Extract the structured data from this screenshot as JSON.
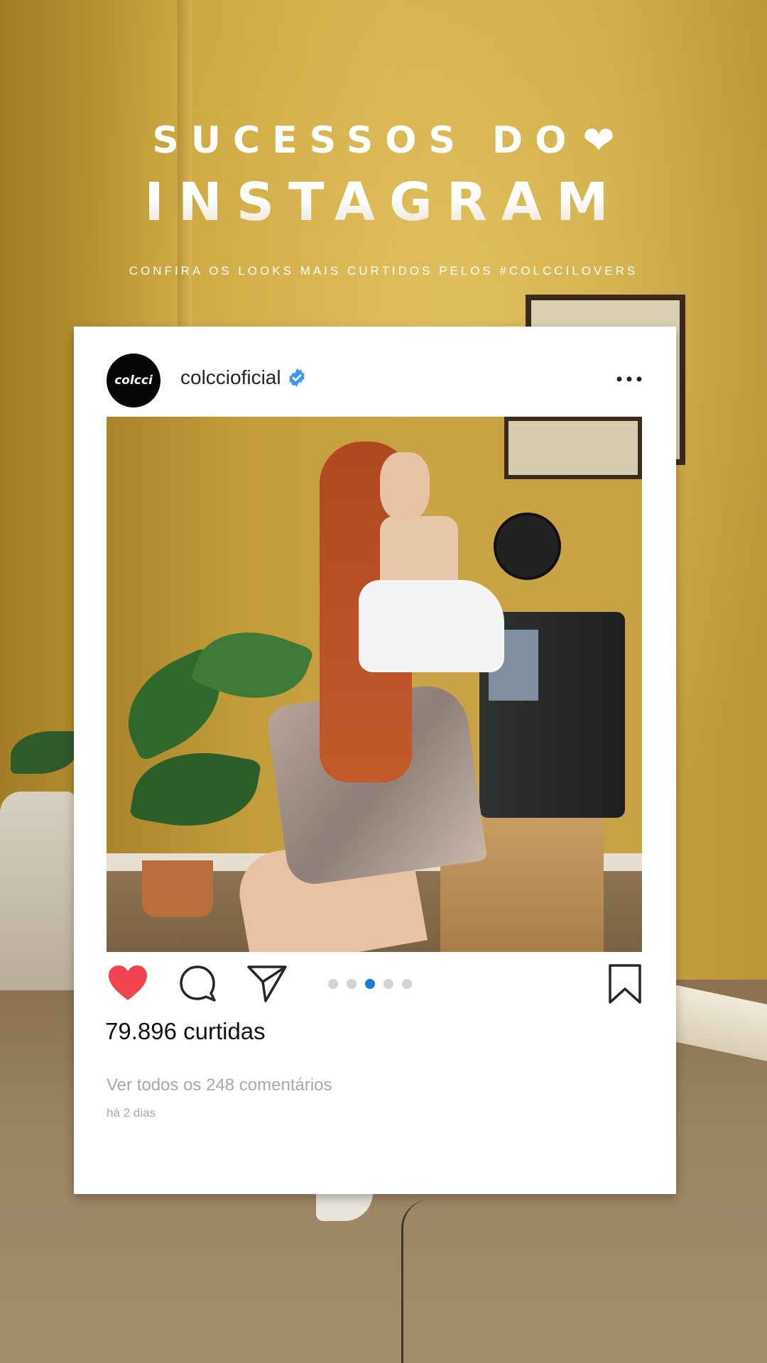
{
  "headline": {
    "line1": "SUCESSOS DO",
    "line2": "INSTAGRAM"
  },
  "subtitle": "CONFIRA OS LOOKS MAIS CURTIDOS PELOS #COLCCILOVERS",
  "post": {
    "avatar_text": "colcci",
    "username": "colccioficial",
    "verified": true,
    "carousel": {
      "count": 5,
      "active_index": 2
    },
    "likes_text": "79.896 curtidas",
    "comments_link": "Ver todos os 248 comentários",
    "timestamp": "há 2 dias"
  },
  "icons": {
    "heart_title": "heart-icon",
    "avatar": "brand-logo",
    "verified": "verified-badge-icon",
    "more": "more-options-icon",
    "like": "heart-icon",
    "comment": "comment-icon",
    "share": "share-icon",
    "bookmark": "bookmark-icon"
  },
  "colors": {
    "like": "#f0454f",
    "verified": "#3897f0",
    "dot_active": "#1a7bd8",
    "dot_inactive": "#d3d3d3",
    "card": "#ffffff",
    "wall": "#c9a23a"
  }
}
